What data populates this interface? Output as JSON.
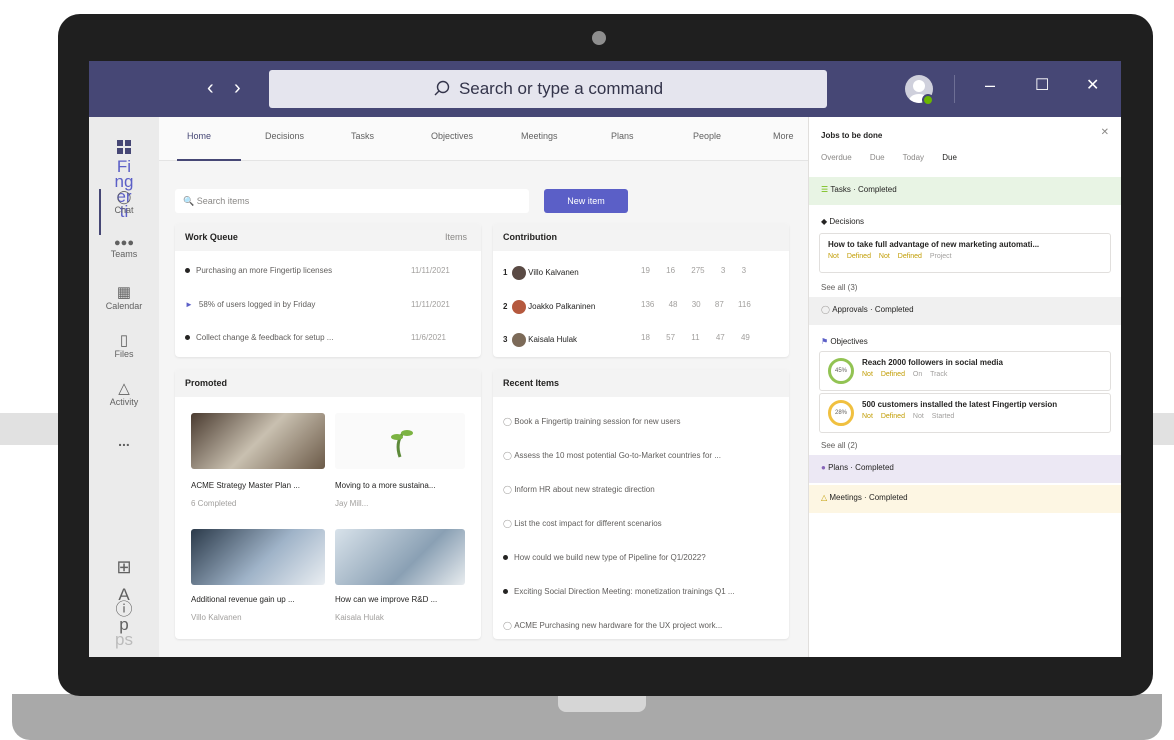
{
  "titlebar": {
    "search_placeholder": "Search or type a command",
    "back_icon": "chevron-left-icon",
    "forward_icon": "chevron-right-icon",
    "minimize": "–",
    "maximize": "☐",
    "close": "✕"
  },
  "rail": {
    "items": [
      {
        "label": "Fi\nng\ner\nti\np",
        "icon": "fingertip-app-icon"
      },
      {
        "label": "Chat",
        "icon": "chat-icon"
      },
      {
        "label": "Teams",
        "icon": "teams-icon"
      },
      {
        "label": "Calendar",
        "icon": "calendar-icon"
      },
      {
        "label": "Files",
        "icon": "files-icon"
      },
      {
        "label": "Activity",
        "icon": "bell-icon"
      },
      {
        "label": "...",
        "icon": "more-icon"
      }
    ],
    "apps_label": "A\np\np\nps"
  },
  "tabs": [
    "Home",
    "Decisions",
    "Tasks",
    "Objectives",
    "Meetings",
    "Plans",
    "People",
    "More"
  ],
  "toolbar": {
    "search_placeholder": "Search items",
    "new_item": "New item"
  },
  "work_queue": {
    "title": "Work Queue",
    "filter": "Items",
    "rows": [
      {
        "text": "Purchasing an more Fingertip licenses",
        "date": "11/11/2021"
      },
      {
        "text": "58% of users logged in by Friday",
        "date": "11/11/2021"
      },
      {
        "text": "Collect change & feedback for setup ...",
        "date": "11/6/2021"
      }
    ]
  },
  "contribution": {
    "title": "Contribution",
    "rows": [
      {
        "rank": "1",
        "name": "Villo Kalvanen",
        "vals": [
          "19",
          "16",
          "275",
          "3",
          "3"
        ]
      },
      {
        "rank": "2",
        "name": "Joakko Palkaninen",
        "vals": [
          "136",
          "48",
          "30",
          "87",
          "116"
        ]
      },
      {
        "rank": "3",
        "name": "Kaisala Hulak",
        "vals": [
          "18",
          "57",
          "11",
          "47",
          "49"
        ]
      }
    ]
  },
  "promoted": {
    "title": "Promoted",
    "cards": [
      {
        "title": "ACME Strategy Master Plan ...",
        "meta": "6 Completed"
      },
      {
        "title": "Moving to a more sustaina...",
        "meta": "Jay Mill..."
      },
      {
        "title": "Additional revenue gain up ...",
        "meta": "Villo Kalvanen"
      },
      {
        "title": "How can we improve R&D ...",
        "meta": "Kaisala Hulak"
      }
    ]
  },
  "recent": {
    "title": "Recent Items",
    "rows": [
      "Book a Fingertip training session for new users",
      "Assess the 10 most potential Go-to-Market countries for ...",
      "Inform HR about new strategic direction",
      "List the cost impact for different scenarios",
      "How could we build new type of Pipeline for Q1/2022?",
      "Exciting Social Direction Meeting: monetization trainings Q1 ...",
      "ACME Purchasing new hardware for the UX project work..."
    ]
  },
  "panel": {
    "title": "Jobs to be done",
    "filters": [
      "Overdue",
      "Due Today",
      "Due"
    ],
    "tasks_completed": "Tasks · Completed",
    "decisions_label": "Decisions",
    "decision_item": "How to take full advantage of new marketing automati...",
    "decision_meta": [
      "Not Defined",
      "Not Defined",
      "Project"
    ],
    "see_all_1": "See all (3)",
    "approvals": "Approvals · Completed",
    "objectives_label": "Objectives",
    "objectives": [
      {
        "pct": "45%",
        "title": "Reach 2000 followers in social media",
        "meta": [
          "Not Defined",
          "On Track"
        ]
      },
      {
        "pct": "28%",
        "title": "500 customers installed the latest Fingertip version",
        "meta": [
          "Not Defined",
          "Not Started"
        ]
      }
    ],
    "see_all_2": "See all (2)",
    "plans": "Plans · Completed",
    "meetings": "Meetings · Completed"
  },
  "colors": {
    "brand": "#464775",
    "accent": "#5b5fc7",
    "green": "#92c353",
    "yellow": "#c19c00"
  }
}
